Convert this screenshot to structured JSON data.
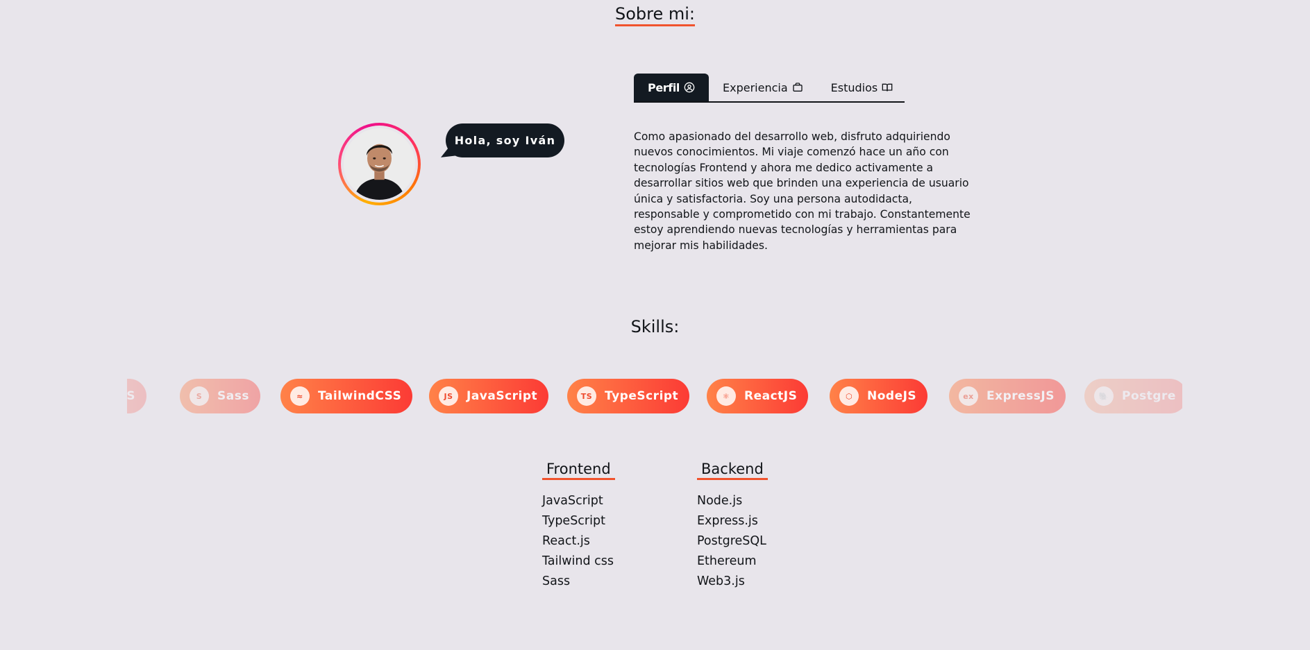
{
  "about": {
    "title": "Sobre mi:",
    "greeting": "Hola, soy Iván",
    "tabs": [
      {
        "label": "Perfil",
        "icon": "user-circle-icon",
        "active": true
      },
      {
        "label": "Experiencia",
        "icon": "briefcase-icon",
        "active": false
      },
      {
        "label": "Estudios",
        "icon": "book-icon",
        "active": false
      }
    ],
    "profile_text": "Como apasionado del desarrollo web, disfruto adquiriendo nuevos conocimientos. Mi viaje comenzó hace un año con tecnologías Frontend y ahora me dedico activamente a desarrollar sitios web que brinden una experiencia de usuario única y satisfactoria. Soy una persona autodidacta, responsable y comprometido con mi trabajo. Constantemente estoy aprendiendo nuevas tecnologías y herramientas para mejorar mis habilidades."
  },
  "skills": {
    "title": "Skills:",
    "carousel": [
      {
        "label": "CSS",
        "icon": "css-icon",
        "icon_text": ""
      },
      {
        "label": "Sass",
        "icon": "sass-icon",
        "icon_text": "S"
      },
      {
        "label": "TailwindCSS",
        "icon": "tailwind-icon",
        "icon_text": "≈"
      },
      {
        "label": "JavaScript",
        "icon": "javascript-icon",
        "icon_text": "JS"
      },
      {
        "label": "TypeScript",
        "icon": "typescript-icon",
        "icon_text": "TS"
      },
      {
        "label": "ReactJS",
        "icon": "react-icon",
        "icon_text": "⚛"
      },
      {
        "label": "NodeJS",
        "icon": "nodejs-icon",
        "icon_text": "⬡"
      },
      {
        "label": "ExpressJS",
        "icon": "express-icon",
        "icon_text": "ex"
      },
      {
        "label": "Postgre",
        "icon": "postgresql-icon",
        "icon_text": "🐘"
      }
    ]
  },
  "lists": {
    "frontend": {
      "title": "Frontend",
      "items": [
        "JavaScript",
        "TypeScript",
        "React.js",
        "Tailwind css",
        "Sass"
      ]
    },
    "backend": {
      "title": "Backend",
      "items": [
        "Node.js",
        "Express.js",
        "PostgreSQL",
        "Ethereum",
        "Web3.js"
      ]
    }
  },
  "colors": {
    "accent": "#f0532d",
    "dark": "#131a22",
    "background": "#e8e5eb"
  }
}
